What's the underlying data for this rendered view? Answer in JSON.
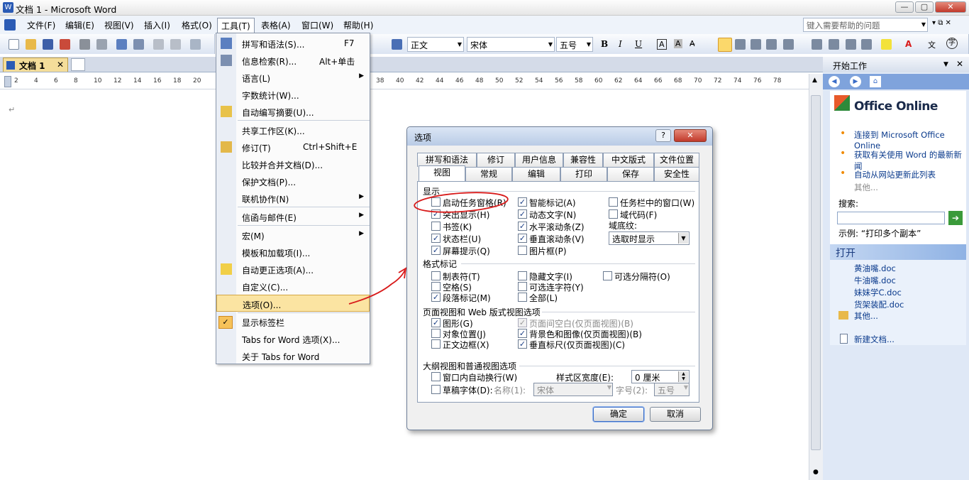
{
  "window": {
    "title": "文档 1 - Microsoft Word"
  },
  "menubar": {
    "items": [
      "文件(F)",
      "编辑(E)",
      "视图(V)",
      "插入(I)",
      "格式(O)",
      "工具(T)",
      "表格(A)",
      "窗口(W)",
      "帮助(H)"
    ],
    "help_placeholder": "键入需要帮助的问题"
  },
  "format": {
    "style": "正文",
    "font": "宋体",
    "size": "五号"
  },
  "doc_tab": {
    "label": "文档 1"
  },
  "ruler": {
    "ticks_left": [
      "2",
      "4",
      "6",
      "8",
      "10",
      "12",
      "14",
      "16",
      "18",
      "20"
    ],
    "ticks_right": [
      "38",
      "40",
      "42",
      "44",
      "46",
      "48",
      "50",
      "52",
      "54",
      "56",
      "58",
      "60",
      "62",
      "64",
      "66",
      "68",
      "70",
      "72",
      "74",
      "76",
      "78"
    ]
  },
  "tools_menu": {
    "items": [
      {
        "label": "拼写和语法(S)...",
        "shortcut": "F7"
      },
      {
        "label": "信息检索(R)...",
        "shortcut": "Alt+单击"
      },
      {
        "label": "语言(L)",
        "sub": "▶"
      },
      {
        "label": "字数统计(W)..."
      },
      {
        "label": "自动编写摘要(U)..."
      },
      {
        "label": "共享工作区(K)..."
      },
      {
        "label": "修订(T)",
        "shortcut": "Ctrl+Shift+E"
      },
      {
        "label": "比较并合并文档(D)..."
      },
      {
        "label": "保护文档(P)..."
      },
      {
        "label": "联机协作(N)",
        "sub": "▶"
      },
      {
        "label": "信函与邮件(E)",
        "sub": "▶"
      },
      {
        "label": "宏(M)",
        "sub": "▶"
      },
      {
        "label": "模板和加载项(I)..."
      },
      {
        "label": "自动更正选项(A)..."
      },
      {
        "label": "自定义(C)..."
      },
      {
        "label": "选项(O)..."
      },
      {
        "label": "显示标签栏"
      },
      {
        "label": "Tabs for Word 选项(X)..."
      },
      {
        "label": "关于 Tabs for Word"
      }
    ]
  },
  "task_pane": {
    "title": "开始工作",
    "logo": "Office Online",
    "links": [
      "连接到 Microsoft Office Online",
      "获取有关使用 Word 的最新新闻",
      "自动从网站更新此列表"
    ],
    "more": "其他...",
    "search_label": "搜索:",
    "example": "示例: “打印多个副本”",
    "open_title": "打开",
    "files": [
      "黄油嘴.doc",
      "牛油嘴.doc",
      "妹妹学C.doc",
      "货架装配.doc"
    ],
    "open_more": "其他...",
    "new_doc": "新建文档..."
  },
  "dialog": {
    "title": "选项",
    "tabs_row1": [
      "拼写和语法",
      "修订",
      "用户信息",
      "兼容性",
      "中文版式",
      "文件位置"
    ],
    "tabs_row2": [
      "视图",
      "常规",
      "编辑",
      "打印",
      "保存",
      "安全性"
    ],
    "show_label": "显示",
    "show_col1": [
      {
        "label": "启动任务窗格(R)",
        "checked": false
      },
      {
        "label": "突出显示(H)",
        "checked": true
      },
      {
        "label": "书签(K)",
        "checked": false
      },
      {
        "label": "状态栏(U)",
        "checked": true
      },
      {
        "label": "屏幕提示(Q)",
        "checked": true
      }
    ],
    "show_col2": [
      {
        "label": "智能标记(A)",
        "checked": true
      },
      {
        "label": "动态文字(N)",
        "checked": true
      },
      {
        "label": "水平滚动条(Z)",
        "checked": true
      },
      {
        "label": "垂直滚动条(V)",
        "checked": true
      },
      {
        "label": "图片框(P)",
        "checked": false
      }
    ],
    "show_col3": [
      {
        "label": "任务栏中的窗口(W)",
        "checked": false
      },
      {
        "label": "域代码(F)",
        "checked": false
      }
    ],
    "field_shading_label": "域底纹:",
    "field_shading_value": "选取时显示",
    "format_marks_label": "格式标记",
    "fm_col1": [
      {
        "label": "制表符(T)",
        "checked": false
      },
      {
        "label": "空格(S)",
        "checked": false
      },
      {
        "label": "段落标记(M)",
        "checked": true
      }
    ],
    "fm_col2": [
      {
        "label": "隐藏文字(I)",
        "checked": false
      },
      {
        "label": "可选连字符(Y)",
        "checked": false
      },
      {
        "label": "全部(L)",
        "checked": false
      }
    ],
    "fm_col3": [
      {
        "label": "可选分隔符(O)",
        "checked": false
      }
    ],
    "print_web_label": "页面视图和 Web 版式视图选项",
    "pw_col1": [
      {
        "label": "图形(G)",
        "checked": true
      },
      {
        "label": "对象位置(J)",
        "checked": false
      },
      {
        "label": "正文边框(X)",
        "checked": false
      }
    ],
    "pw_col2": [
      {
        "label": "页面间空白(仅页面视图)(B)",
        "checked": true,
        "disabled": true
      },
      {
        "label": "背景色和图像(仅页面视图)(B)",
        "checked": true
      },
      {
        "label": "垂直标尺(仅页面视图)(C)",
        "checked": true
      }
    ],
    "outline_label": "大纲视图和普通视图选项",
    "wrap_label": "窗口内自动换行(W)",
    "draft_label": "草稿字体(D):",
    "name_label": "名称(1):",
    "name_value": "宋体",
    "style_width_label": "样式区宽度(E):",
    "style_width_value": "0 厘米",
    "size_label": "字号(2):",
    "size_value": "五号",
    "ok": "确定",
    "cancel": "取消"
  },
  "colors": {
    "accent": "#3a6cc7",
    "highlight": "#fbe4a2",
    "annotation": "#d81a1a"
  }
}
